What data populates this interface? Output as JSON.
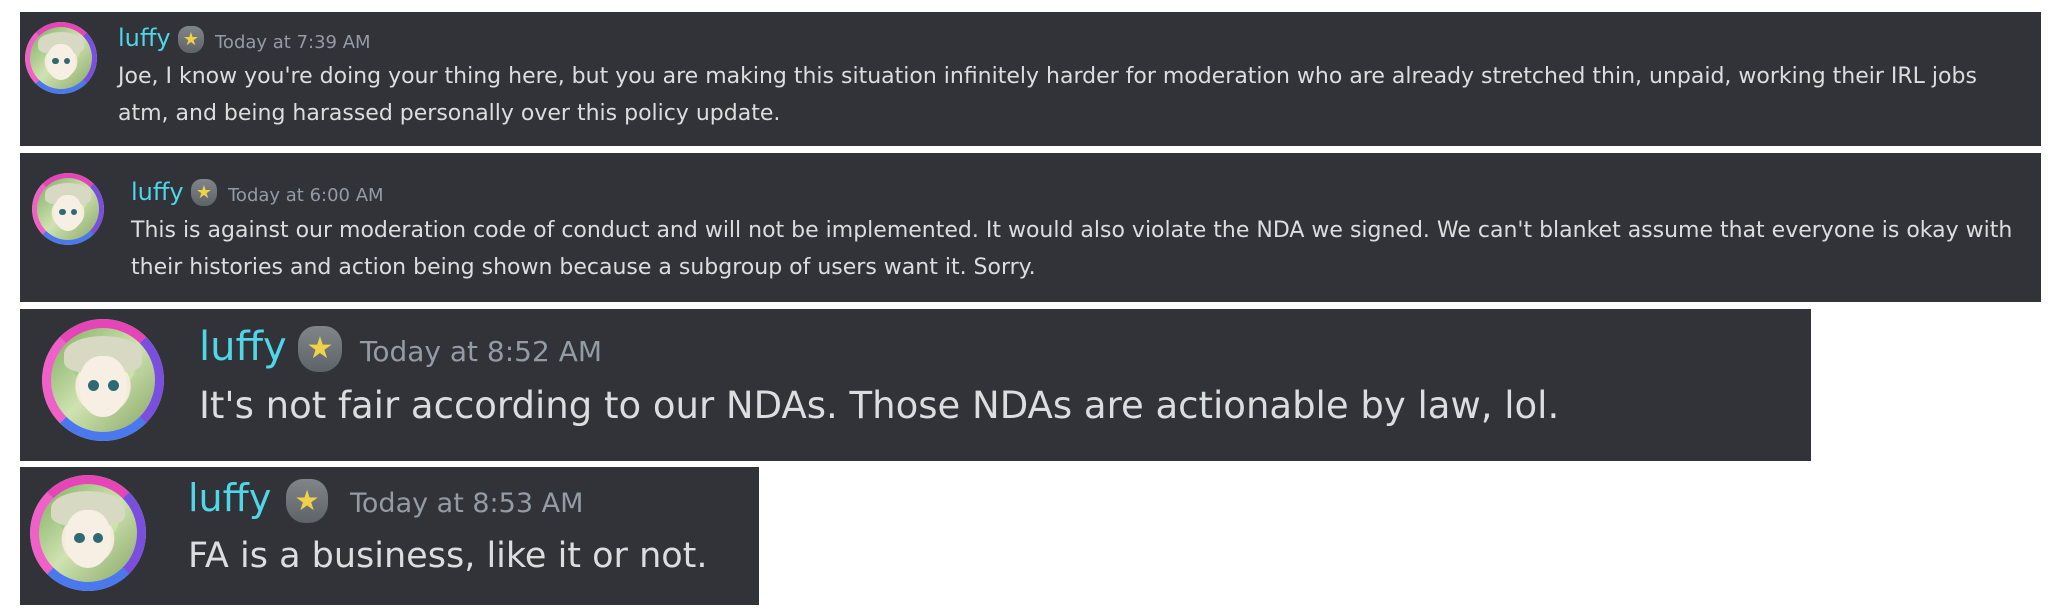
{
  "messages": [
    {
      "username": "luffy",
      "timestamp": "Today at 7:39 AM",
      "text": "Joe, I know you're doing your thing here, but you are making this situation infinitely harder for moderation who are already stretched thin, unpaid, working their IRL jobs atm, and being harassed personally over this policy update."
    },
    {
      "username": "luffy",
      "timestamp": "Today at 6:00 AM",
      "text": "This is against our moderation code of conduct and will not be implemented. It would also violate the NDA we signed. We can't blanket assume that everyone is okay with their histories and action being shown because a subgroup of users want it. Sorry."
    },
    {
      "username": "luffy",
      "timestamp": "Today at 8:52 AM",
      "text": "It's not fair according to our NDAs. Those NDAs are actionable by law, lol."
    },
    {
      "username": "luffy",
      "timestamp": "Today at 8:53 AM",
      "text": "FA is a business, like it or not."
    }
  ],
  "badge_icon": "star-shield-icon",
  "avatar_icon": "anime-avatar-icon",
  "colors": {
    "background": "#313338",
    "username": "#4fd6e8",
    "timestamp": "#949ba4",
    "text": "#dbdee1"
  }
}
